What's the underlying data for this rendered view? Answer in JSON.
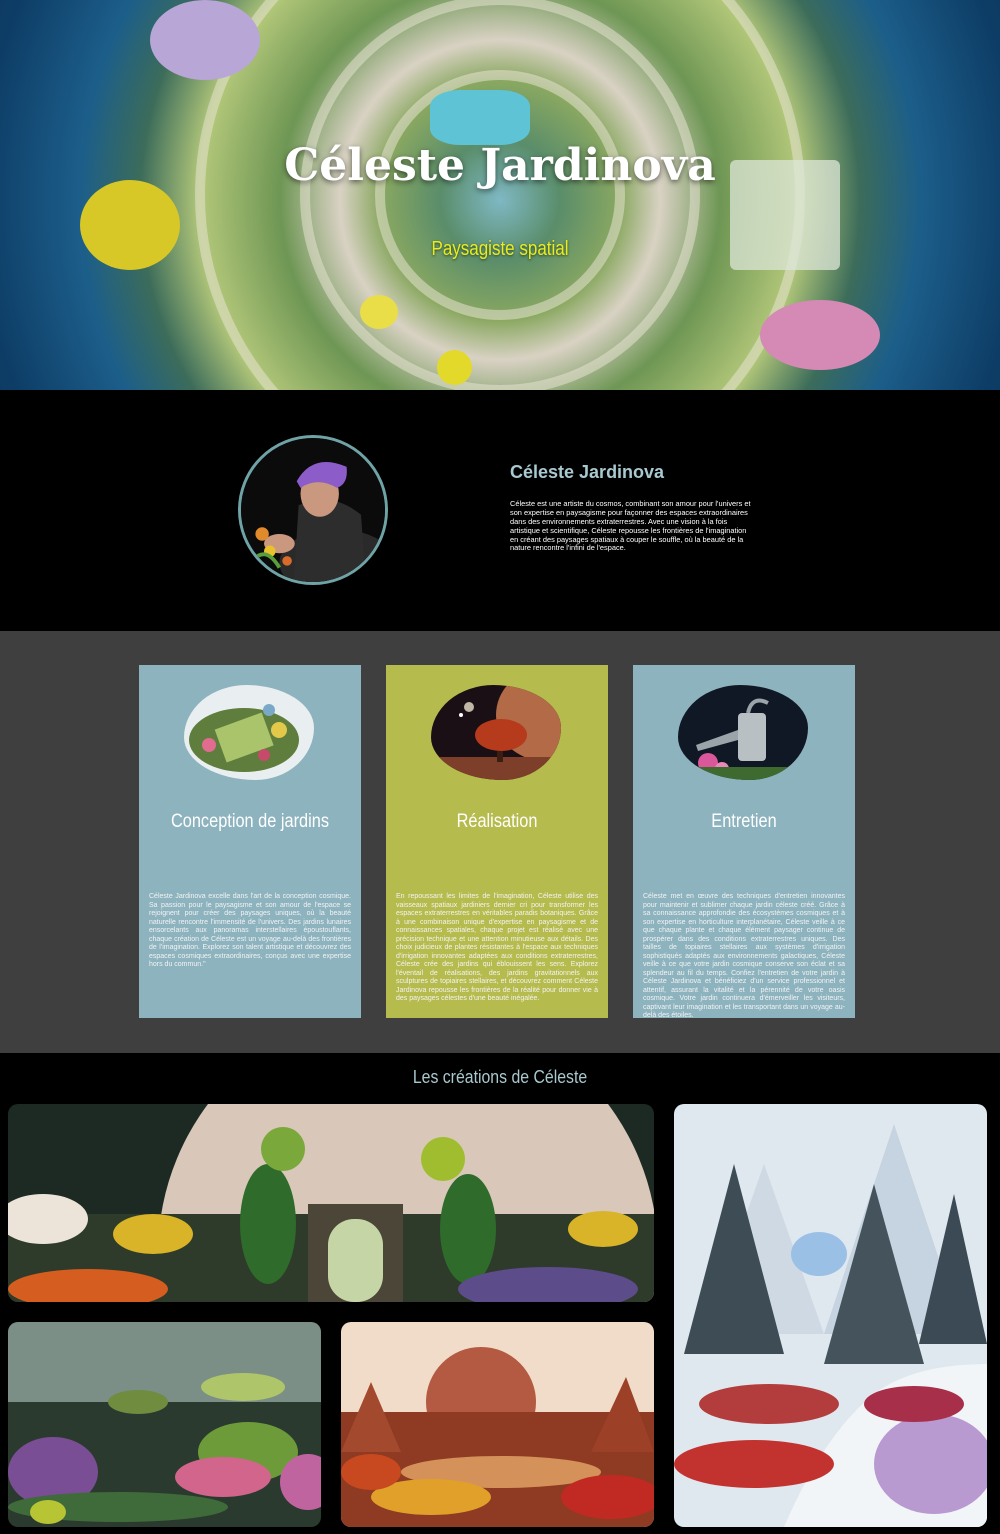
{
  "hero": {
    "title": "Céleste Jardinova",
    "subtitle": "Paysagiste spatial"
  },
  "about": {
    "name": "Céleste Jardinova",
    "text": "Céleste est une artiste du cosmos, combinant son amour pour l'univers et son expertise en paysagisme pour façonner des espaces extraordinaires dans des environnements extraterrestres. Avec une vision à la fois artistique et scientifique, Céleste repousse les frontières de l'imagination en créant des paysages spatiaux à couper le souffle, où la beauté de la nature rencontre l'infini de l'espace."
  },
  "services": [
    {
      "title": "Conception de jardins",
      "text": "Céleste Jardinova excelle dans l'art de la conception cosmique. Sa passion pour le paysagisme et son amour de l'espace se rejoignent pour créer des paysages uniques, où la beauté naturelle rencontre l'immensité de l'univers. Des jardins lunaires ensorcelants aux panoramas interstellaires époustouflants, chaque création de Céleste est un voyage au-delà des frontières de l'imagination. Explorez son talent artistique et découvrez des espaces cosmiques extraordinaires, conçus avec une expertise hors du commun.\""
    },
    {
      "title": "Réalisation",
      "text": "En repoussant les limites de l'imagination, Céleste utilise des vaisseaux spatiaux jardiniers dernier cri pour transformer les espaces extraterrestres en véritables paradis botaniques. Grâce à une combinaison unique d'expertise en paysagisme et de connaissances spatiales, chaque projet est réalisé avec une précision technique et une attention minutieuse aux détails. Des choix judicieux de plantes résistantes à l'espace aux techniques d'irrigation innovantes adaptées aux conditions extraterrestres, Céleste crée des jardins qui éblouissent les sens. Explorez l'éventail de réalisations, des jardins gravitationnels aux sculptures de topiaires stellaires, et découvrez comment Céleste Jardinova repousse les frontières de la réalité pour donner vie à des paysages célestes d'une beauté inégalée."
    },
    {
      "title": "Entretien",
      "text": "Céleste met en œuvre des techniques d'entretien innovantes pour maintenir et sublimer chaque jardin céleste créé. Grâce à sa connaissance approfondie des écosystèmes cosmiques et à son expertise en horticulture interplanétaire, Céleste veille à ce que chaque plante et chaque élément paysager continue de prospérer dans des conditions extraterrestres uniques. Des tailles de topiaires stellaires aux systèmes d'irrigation sophistiqués adaptés aux environnements galactiques, Céleste veille à ce que votre jardin cosmique conserve son éclat et sa splendeur au fil du temps. Confiez l'entretien de votre jardin à Céleste Jardinova et bénéficiez d'un service professionnel et attentif, assurant la vitalité et la pérennité de votre oasis cosmique. Votre jardin continuera d'émerveiller les visiteurs, captivant leur imagination et les transportant dans un voyage au-delà des étoiles."
    }
  ],
  "gallery": {
    "heading": "Les créations de Céleste"
  },
  "colors": {
    "accent_teal": "#8db3bf",
    "accent_olive": "#b6bb4d",
    "heading_blue": "#a8c9cf",
    "subtitle_yellow": "#e8ee1a",
    "services_bg": "#3f3f3f"
  }
}
